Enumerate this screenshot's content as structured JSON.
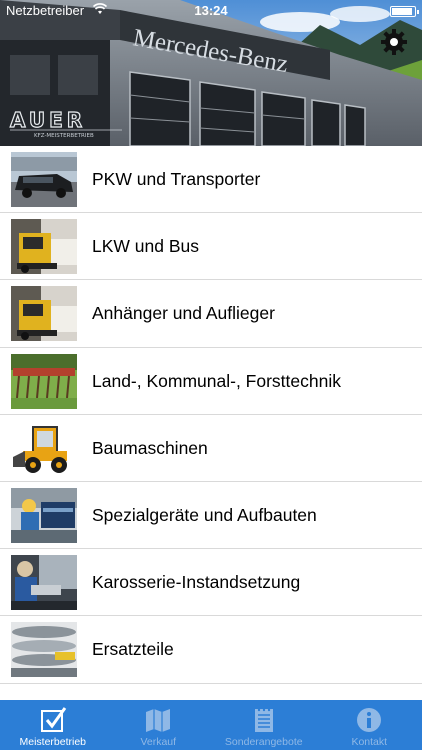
{
  "status_bar": {
    "carrier": "Netzbetreiber",
    "time": "13:24"
  },
  "header": {
    "building_sign": "Mercedes-Benz",
    "logo_text": "AUER",
    "logo_subtitle": "KFZ-MEISTERBETRIEB"
  },
  "categories": [
    {
      "label": "PKW und Transporter",
      "image": "van"
    },
    {
      "label": "LKW und Bus",
      "image": "truck"
    },
    {
      "label": "Anhänger und Auflieger",
      "image": "truck"
    },
    {
      "label": "Land-, Kommunal-, Forsttechnik",
      "image": "agri"
    },
    {
      "label": "Baumaschinen",
      "image": "loader"
    },
    {
      "label": "Spezialgeräte und Aufbauten",
      "image": "workshop"
    },
    {
      "label": "Karosserie-Instandsetzung",
      "image": "bodywork"
    },
    {
      "label": "Ersatzteile",
      "image": "parts"
    }
  ],
  "tabbar": {
    "tabs": [
      {
        "label": "Meisterbetrieb",
        "icon": "checkmark-icon",
        "active": true
      },
      {
        "label": "Verkauf",
        "icon": "map-icon",
        "active": false
      },
      {
        "label": "Sonderangebote",
        "icon": "notepad-icon",
        "active": false
      },
      {
        "label": "Kontakt",
        "icon": "info-icon",
        "active": false
      }
    ]
  },
  "colors": {
    "tabbar_bg": "#2c7ed6",
    "tab_active": "#ffffff",
    "tab_inactive": "#8fb8e6"
  }
}
